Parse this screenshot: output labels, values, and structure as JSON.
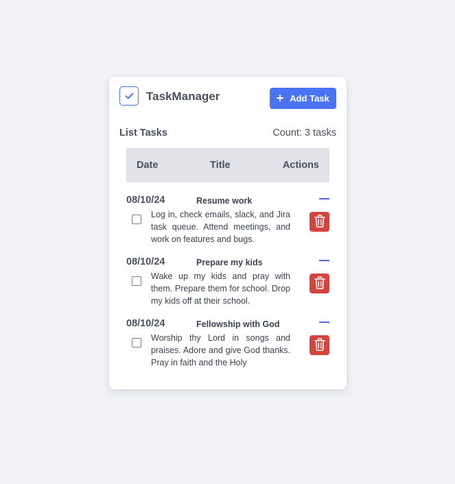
{
  "app": {
    "title": "TaskManager",
    "add_button_label": "Add Task"
  },
  "list": {
    "label": "List Tasks",
    "count_text": "Count: 3 tasks"
  },
  "table": {
    "headers": [
      "Date",
      "Title",
      "Actions"
    ]
  },
  "tasks": [
    {
      "date": "08/10/24",
      "title": "Resume work",
      "description": "Log in, check emails, slack, and Jira task queue. Attend meetings, and work on features and bugs.",
      "completed": false
    },
    {
      "date": "08/10/24",
      "title": "Prepare my kids",
      "description": "Wake up my kids and pray with them. Prepare them for school. Drop my kids off at their school.",
      "completed": false
    },
    {
      "date": "08/10/24",
      "title": "Fellowship with God",
      "description": "Worship thy Lord in songs and praises. Adore and give God thanks. Pray in faith and the Holy",
      "completed": false
    }
  ],
  "colors": {
    "accent": "#4b74f4",
    "danger": "#d5433e",
    "collapse": "#5a63e6",
    "background": "#f0f2f6",
    "header_bg": "#e2e3e8"
  },
  "icons": {
    "logo": "check-icon",
    "add": "plus-icon",
    "collapse": "minus-icon",
    "delete": "trash-icon"
  }
}
